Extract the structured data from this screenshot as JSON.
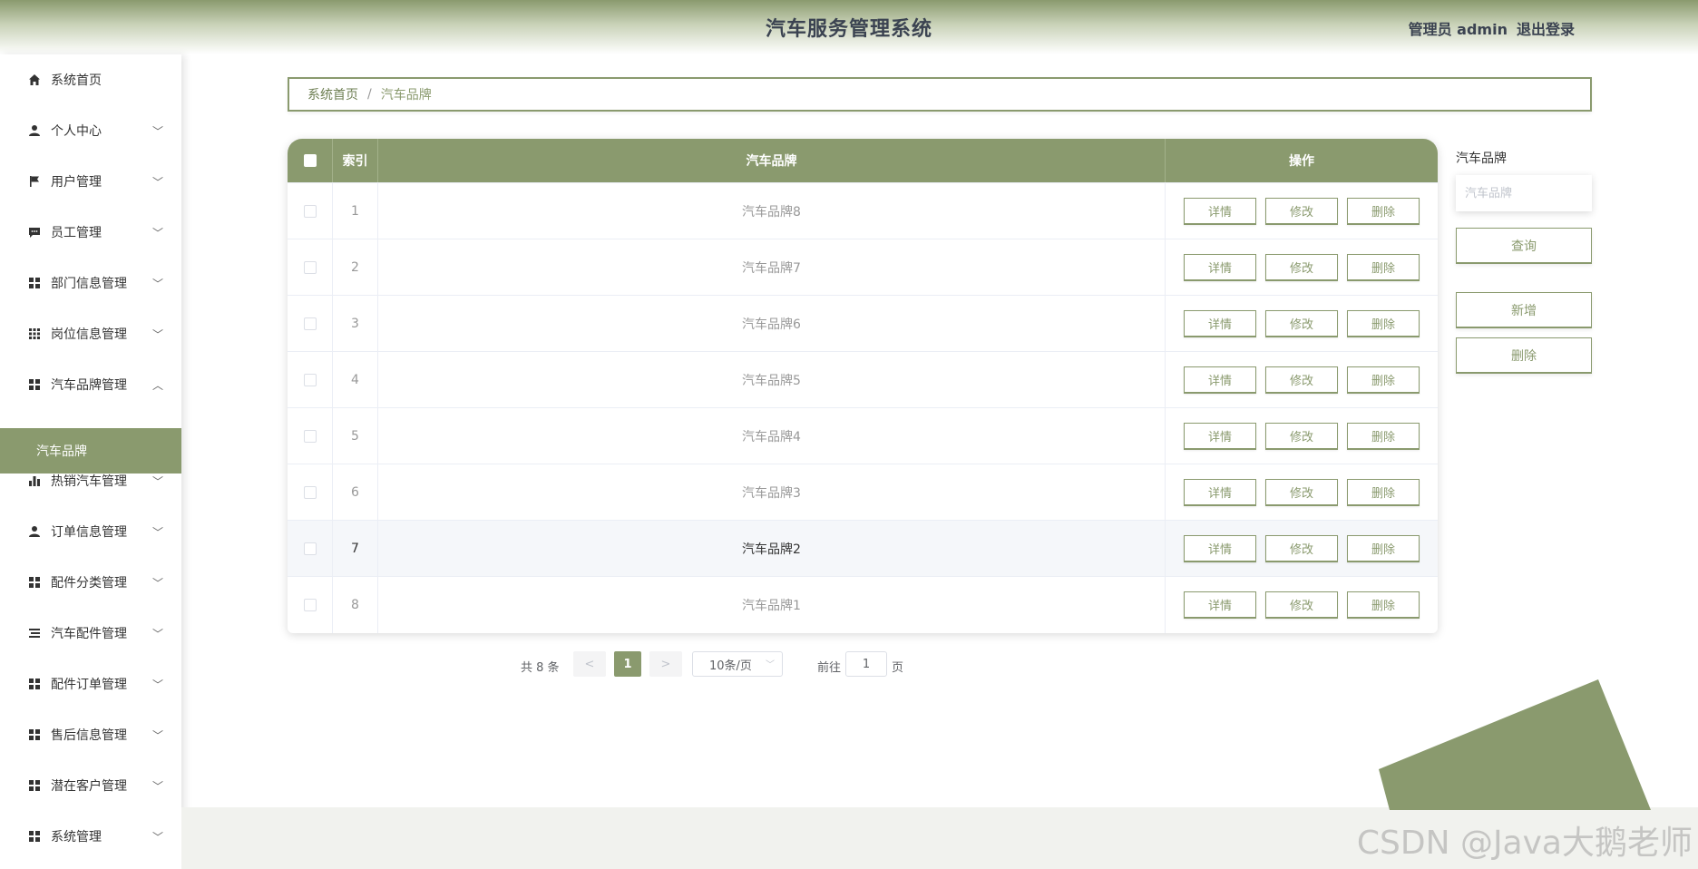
{
  "header": {
    "title": "汽车服务管理系统",
    "user": "管理员 admin",
    "logout": "退出登录"
  },
  "sidebar": {
    "items": [
      {
        "label": "系统首页",
        "icon": "home-icon"
      },
      {
        "label": "个人中心",
        "icon": "user-icon"
      },
      {
        "label": "用户管理",
        "icon": "flag-icon"
      },
      {
        "label": "员工管理",
        "icon": "chat-icon"
      },
      {
        "label": "部门信息管理",
        "icon": "grid-icon"
      },
      {
        "label": "岗位信息管理",
        "icon": "apps-icon"
      },
      {
        "label": "汽车品牌管理",
        "icon": "grid-icon"
      },
      {
        "label": "热销汽车管理",
        "icon": "bar-chart-icon"
      },
      {
        "label": "订单信息管理",
        "icon": "user-icon"
      },
      {
        "label": "配件分类管理",
        "icon": "grid-icon"
      },
      {
        "label": "汽车配件管理",
        "icon": "list-icon"
      },
      {
        "label": "配件订单管理",
        "icon": "grid-icon"
      },
      {
        "label": "售后信息管理",
        "icon": "grid-icon"
      },
      {
        "label": "潜在客户管理",
        "icon": "grid-icon"
      },
      {
        "label": "系统管理",
        "icon": "grid-icon"
      }
    ],
    "active_sub": "汽车品牌",
    "chevron_down": "﹀",
    "chevron_up": "︿"
  },
  "breadcrumb": {
    "home": "系统首页",
    "sep": "/",
    "current": "汽车品牌"
  },
  "table": {
    "columns": [
      "索引",
      "汽车品牌",
      "操作"
    ],
    "rows": [
      {
        "index": "1",
        "brand": "汽车品牌8"
      },
      {
        "index": "2",
        "brand": "汽车品牌7"
      },
      {
        "index": "3",
        "brand": "汽车品牌6"
      },
      {
        "index": "4",
        "brand": "汽车品牌5"
      },
      {
        "index": "5",
        "brand": "汽车品牌4"
      },
      {
        "index": "6",
        "brand": "汽车品牌3"
      },
      {
        "index": "7",
        "brand": "汽车品牌2"
      },
      {
        "index": "8",
        "brand": "汽车品牌1"
      }
    ],
    "actions": {
      "detail": "详情",
      "edit": "修改",
      "delete": "删除"
    }
  },
  "pagination": {
    "total": "共 8 条",
    "prev": "<",
    "current": "1",
    "next": ">",
    "page_size": "10条/页",
    "goto_label": "前往",
    "goto_value": "1",
    "page_suffix": "页"
  },
  "search": {
    "label": "汽车品牌",
    "placeholder": "汽车品牌",
    "query": "查询",
    "add": "新增",
    "delete": "删除"
  },
  "watermark": "CSDN @Java大鹅老师",
  "colors": {
    "accent": "#8a9a6e",
    "accent_dark": "#6e7f53"
  }
}
